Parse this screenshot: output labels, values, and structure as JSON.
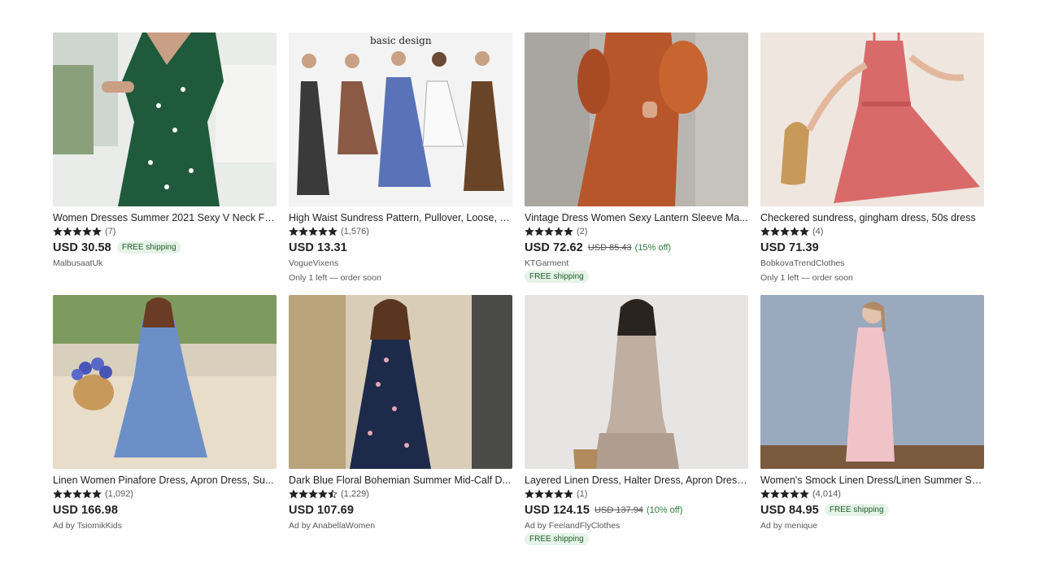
{
  "listings": [
    {
      "title": "Women Dresses Summer 2021 Sexy V Neck Flo...",
      "rating_count": "(7)",
      "rating": 5,
      "price": "USD 30.58",
      "free_shipping": "FREE shipping",
      "shop": "MalbusaatUk",
      "bg": "#e9ece9",
      "dress": "#1f5a3c"
    },
    {
      "title": "High Waist Sundress Pattern, Pullover, Loose, S...",
      "rating_count": "(1,576)",
      "rating": 5,
      "price": "USD 13.31",
      "shop": "VogueVixens",
      "stock": "Only 1 left — order soon",
      "image_text": "basic design",
      "bg": "#f3f3f3",
      "dress": "#3b5a8f"
    },
    {
      "title": "Vintage Dress Women Sexy Lantern Sleeve Ma...",
      "rating_count": "(2)",
      "rating": 5,
      "price": "USD 72.62",
      "orig_price": "USD 85.43",
      "discount": "(15% off)",
      "shop": "KTGarment",
      "free_shipping": "FREE shipping",
      "bg": "#b9b6b1",
      "dress": "#b8562b"
    },
    {
      "title": "Checkered sundress, gingham dress, 50s dress",
      "rating_count": "(4)",
      "rating": 5,
      "price": "USD 71.39",
      "shop": "BobkovaTrendClothes",
      "stock": "Only 1 left — order soon",
      "bg": "#efe6df",
      "dress": "#d96a6a"
    },
    {
      "title": "Linen Women Pinafore Dress, Apron Dress, Su...",
      "rating_count": "(1,092)",
      "rating": 5,
      "price": "USD 166.98",
      "shop": "Ad by TsiomikKids",
      "bg": "#e8ddc9",
      "dress": "#6d8fc7"
    },
    {
      "title": "Dark Blue Floral Bohemian Summer Mid-Calf D...",
      "rating_count": "(1,229)",
      "rating": 4.5,
      "price": "USD 107.69",
      "shop": "Ad by AnabellaWomen",
      "bg": "#d9cdb8",
      "dress": "#1e2a4a"
    },
    {
      "title": "Layered Linen Dress, Halter Dress, Apron Dress...",
      "rating_count": "(1)",
      "rating": 5,
      "price": "USD 124.15",
      "orig_price": "USD 137.94",
      "discount": "(10% off)",
      "shop": "Ad by FeelandFlyClothes",
      "free_shipping": "FREE shipping",
      "bg": "#e6e5e3",
      "dress": "#bfaea2"
    },
    {
      "title": "Women's Smock Linen Dress/Linen Summer Su...",
      "rating_count": "(4,014)",
      "rating": 5,
      "price": "USD 84.95",
      "free_shipping": "FREE shipping",
      "shop": "Ad by menique",
      "bg": "#8fa0b5",
      "dress": "#f0c3c8"
    }
  ]
}
